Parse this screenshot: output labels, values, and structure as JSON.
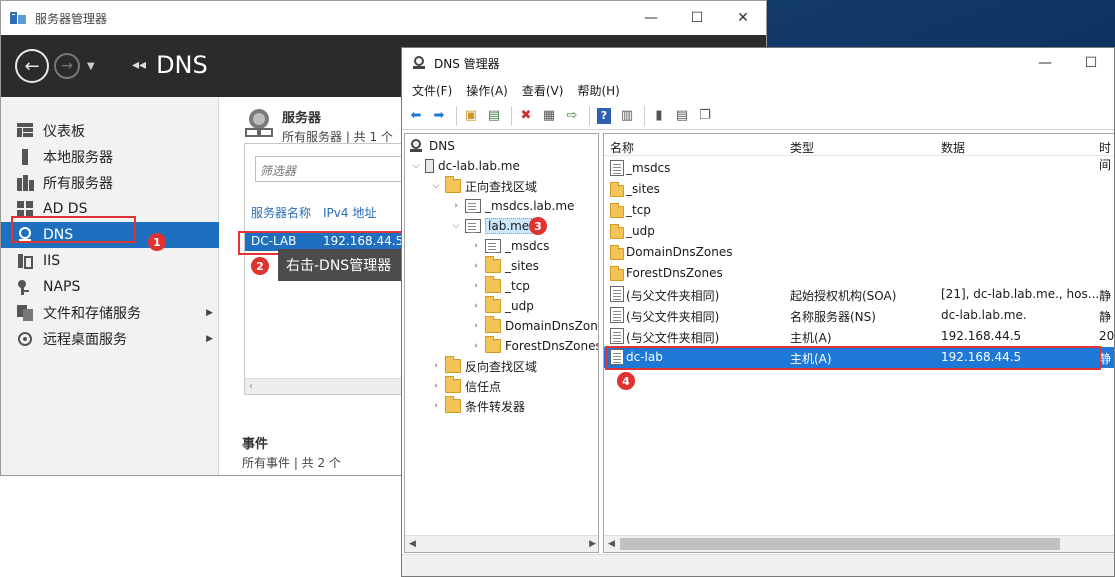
{
  "server_manager": {
    "title": "服务器管理器",
    "breadcrumb_sep": "◂◂",
    "breadcrumb": "DNS",
    "sidebar": [
      {
        "label": "仪表板",
        "icon": "dashboard-icon"
      },
      {
        "label": "本地服务器",
        "icon": "local-server-icon"
      },
      {
        "label": "所有服务器",
        "icon": "all-servers-icon"
      },
      {
        "label": "AD DS",
        "icon": "ad-ds-icon"
      },
      {
        "label": "DNS",
        "icon": "dns-icon"
      },
      {
        "label": "IIS",
        "icon": "iis-icon"
      },
      {
        "label": "NAPS",
        "icon": "naps-icon"
      },
      {
        "label": "文件和存储服务",
        "icon": "file-storage-icon"
      },
      {
        "label": "远程桌面服务",
        "icon": "remote-desktop-icon"
      }
    ],
    "servers": {
      "title": "服务器",
      "subtitle": "所有服务器 | 共 1 个",
      "filter_placeholder": "筛选器",
      "col_name": "服务器名称",
      "col_ip": "IPv4 地址",
      "row": {
        "name": "DC-LAB",
        "ip": "192.168.44.5"
      }
    },
    "events": {
      "title": "事件",
      "subtitle": "所有事件 | 共 2 个"
    }
  },
  "annotations": {
    "b1": "1",
    "b2": "2",
    "b3": "3",
    "b4": "4",
    "tip": "右击-DNS管理器"
  },
  "dns_manager": {
    "title": "DNS 管理器",
    "menu": [
      "文件(F)",
      "操作(A)",
      "查看(V)",
      "帮助(H)"
    ],
    "tree": {
      "root": "DNS",
      "server": "dc-lab.lab.me",
      "forward": "正向查找区域",
      "msdcs_zone": "_msdcs.lab.me",
      "lab_me": "lab.me",
      "lab_children": [
        "_msdcs",
        "_sites",
        "_tcp",
        "_udp",
        "DomainDnsZones",
        "ForestDnsZones"
      ],
      "reverse": "反向查找区域",
      "trust": "信任点",
      "forwarders": "条件转发器"
    },
    "list": {
      "headers": {
        "name": "名称",
        "type": "类型",
        "data": "数据",
        "time": "时间"
      },
      "rows": [
        {
          "name": "_msdcs",
          "type": "",
          "data": "",
          "time": "",
          "icon": "folder-msdcs"
        },
        {
          "name": "_sites",
          "type": "",
          "data": "",
          "time": "",
          "icon": "folder"
        },
        {
          "name": "_tcp",
          "type": "",
          "data": "",
          "time": "",
          "icon": "folder"
        },
        {
          "name": "_udp",
          "type": "",
          "data": "",
          "time": "",
          "icon": "folder"
        },
        {
          "name": "DomainDnsZones",
          "type": "",
          "data": "",
          "time": "",
          "icon": "folder"
        },
        {
          "name": "ForestDnsZones",
          "type": "",
          "data": "",
          "time": "",
          "icon": "folder"
        },
        {
          "name": "(与父文件夹相同)",
          "type": "起始授权机构(SOA)",
          "data": "[21], dc-lab.lab.me., hos...",
          "time": "静",
          "icon": "record"
        },
        {
          "name": "(与父文件夹相同)",
          "type": "名称服务器(NS)",
          "data": "dc-lab.lab.me.",
          "time": "静",
          "icon": "record"
        },
        {
          "name": "(与父文件夹相同)",
          "type": "主机(A)",
          "data": "192.168.44.5",
          "time": "20",
          "icon": "record"
        },
        {
          "name": "dc-lab",
          "type": "主机(A)",
          "data": "192.168.44.5",
          "time": "静",
          "icon": "record"
        }
      ]
    }
  }
}
